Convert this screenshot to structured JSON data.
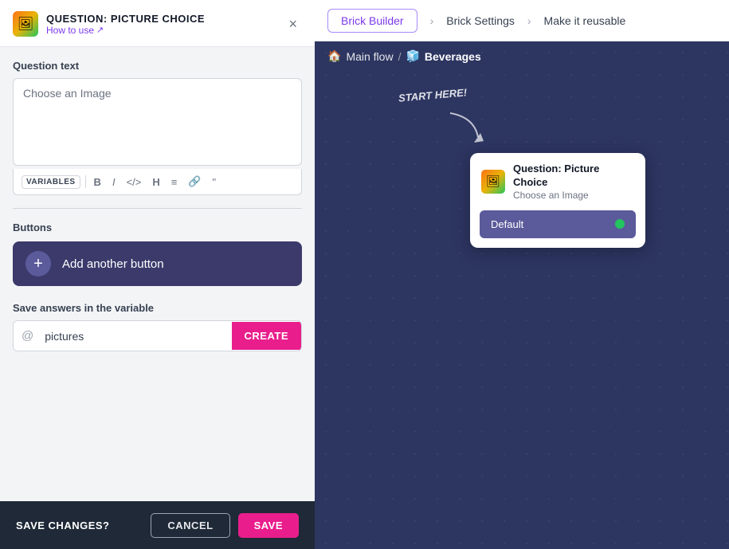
{
  "nav": {
    "tab_active": "Brick Builder",
    "sep1": "›",
    "item1": "Brick Settings",
    "sep2": "›",
    "item2": "Make it reusable"
  },
  "panel": {
    "title": "QUESTION: PICTURE CHOICE",
    "how_to_use": "How to use",
    "close_label": "×",
    "question_text_label": "Question text",
    "question_placeholder": "Choose an Image",
    "toolbar": {
      "variables": "VARIABLES",
      "bold": "B",
      "italic": "I",
      "code": "</>",
      "heading": "H",
      "list": "≡",
      "link": "🔗",
      "quote": "❝"
    },
    "buttons_label": "Buttons",
    "add_button_text": "Add another button",
    "variable_label": "Save answers in the variable",
    "variable_at": "@",
    "variable_value": "pictures",
    "create_btn": "CREATE"
  },
  "bottom_bar": {
    "save_changes_text": "SAVE CHANGES?",
    "cancel_label": "CANCEL",
    "save_label": "SAVE"
  },
  "canvas": {
    "breadcrumb_icon": "🏠",
    "breadcrumb_main": "Main flow",
    "sep": "/",
    "breadcrumb_icon2": "🧊",
    "breadcrumb_current": "Beverages",
    "start_here": "START HERE!",
    "card": {
      "title": "Question: Picture Choice",
      "subtitle": "Choose an Image",
      "default_label": "Default"
    }
  }
}
